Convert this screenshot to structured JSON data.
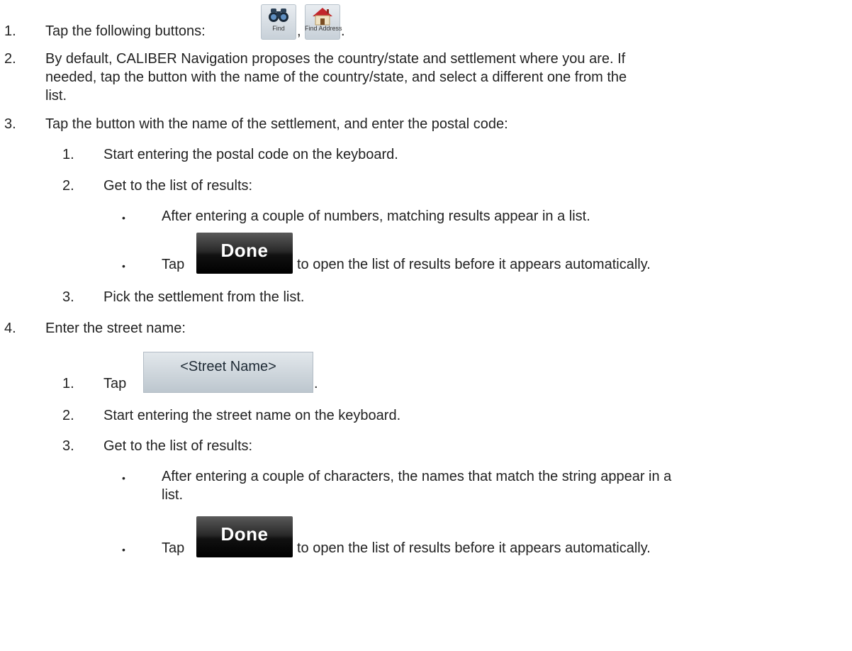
{
  "steps": {
    "s1": {
      "num": "1.",
      "text": "Tap the following buttons:",
      "find_icon_label": "Find",
      "find_address_icon_label": "Find Address",
      "comma": ",",
      "period": "."
    },
    "s2": {
      "num": "2.",
      "line1": "By default, CALIBER Navigation proposes the country/state and settlement where you are. If",
      "line2": "needed, tap the button with the name of the country/state, and select a different one from the",
      "line3": "list."
    },
    "s3": {
      "num": "3.",
      "text": "Tap the button with the name of the settlement, and enter the postal code:",
      "sub1": {
        "num": "1.",
        "text": "Start entering the postal code on the keyboard."
      },
      "sub2": {
        "num": "2.",
        "text": "Get to the list of results:",
        "bullet1": "After entering a couple of numbers, matching results appear in a list.",
        "bullet2_pre": "Tap",
        "bullet2_button": "Done",
        "bullet2_post": "to open the list of results before it appears automatically."
      },
      "sub3": {
        "num": "3.",
        "text": "Pick the settlement from the list."
      }
    },
    "s4": {
      "num": "4.",
      "text": "Enter the street name:",
      "sub1": {
        "num": "1.",
        "pre": "Tap",
        "button": "<Street Name>",
        "post": "."
      },
      "sub2": {
        "num": "2.",
        "text": "Start entering the street name on the keyboard."
      },
      "sub3": {
        "num": "3.",
        "text": "Get to the list of results:",
        "bullet1_line1": "After entering a couple of characters, the names that match the string appear in a",
        "bullet1_line2": "list.",
        "bullet2_pre": "Tap",
        "bullet2_button": "Done",
        "bullet2_post": "to open the list of results before it appears automatically."
      }
    }
  },
  "bullet_char": "•",
  "icons": [
    "binoculars-icon",
    "house-icon"
  ]
}
